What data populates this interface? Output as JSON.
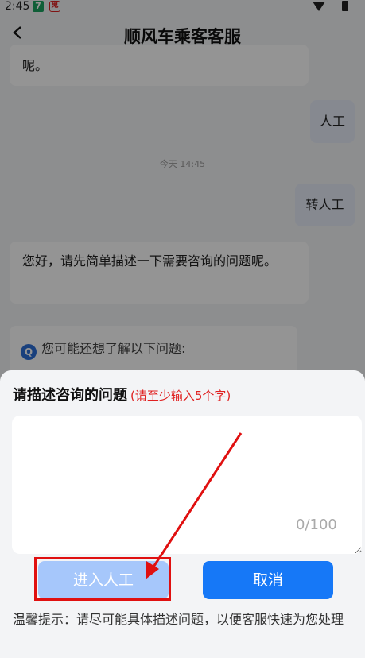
{
  "status_bar": {
    "time": "2:45",
    "icon1": "7",
    "icon2": "鬼"
  },
  "header": {
    "title": "顺风车乘客客服",
    "back_icon": "chevron-left-icon"
  },
  "chat": {
    "msg_top_partial": "呢。",
    "user_msg_1": "人工",
    "timestamp": "今天 14:45",
    "user_msg_2": "转人工",
    "bot_msg": "您好，请先简单描述一下需要咨询的问题呢。",
    "suggest_title": "您可能还想了解以下问题:",
    "suggest_icon": "Q"
  },
  "sheet": {
    "title": "请描述咨询的问题",
    "hint": "(请至少输入5个字)",
    "input_value": "",
    "counter": "0/100",
    "enter_button": "进入人工",
    "cancel_button": "取消",
    "tip": "温馨提示：请尽可能具体描述问题，以便客服快速为您处理"
  },
  "colors": {
    "primary": "#1678f7",
    "disabled": "#a6c7fb",
    "hint_red": "#e02020",
    "annotation": "#e01010"
  }
}
